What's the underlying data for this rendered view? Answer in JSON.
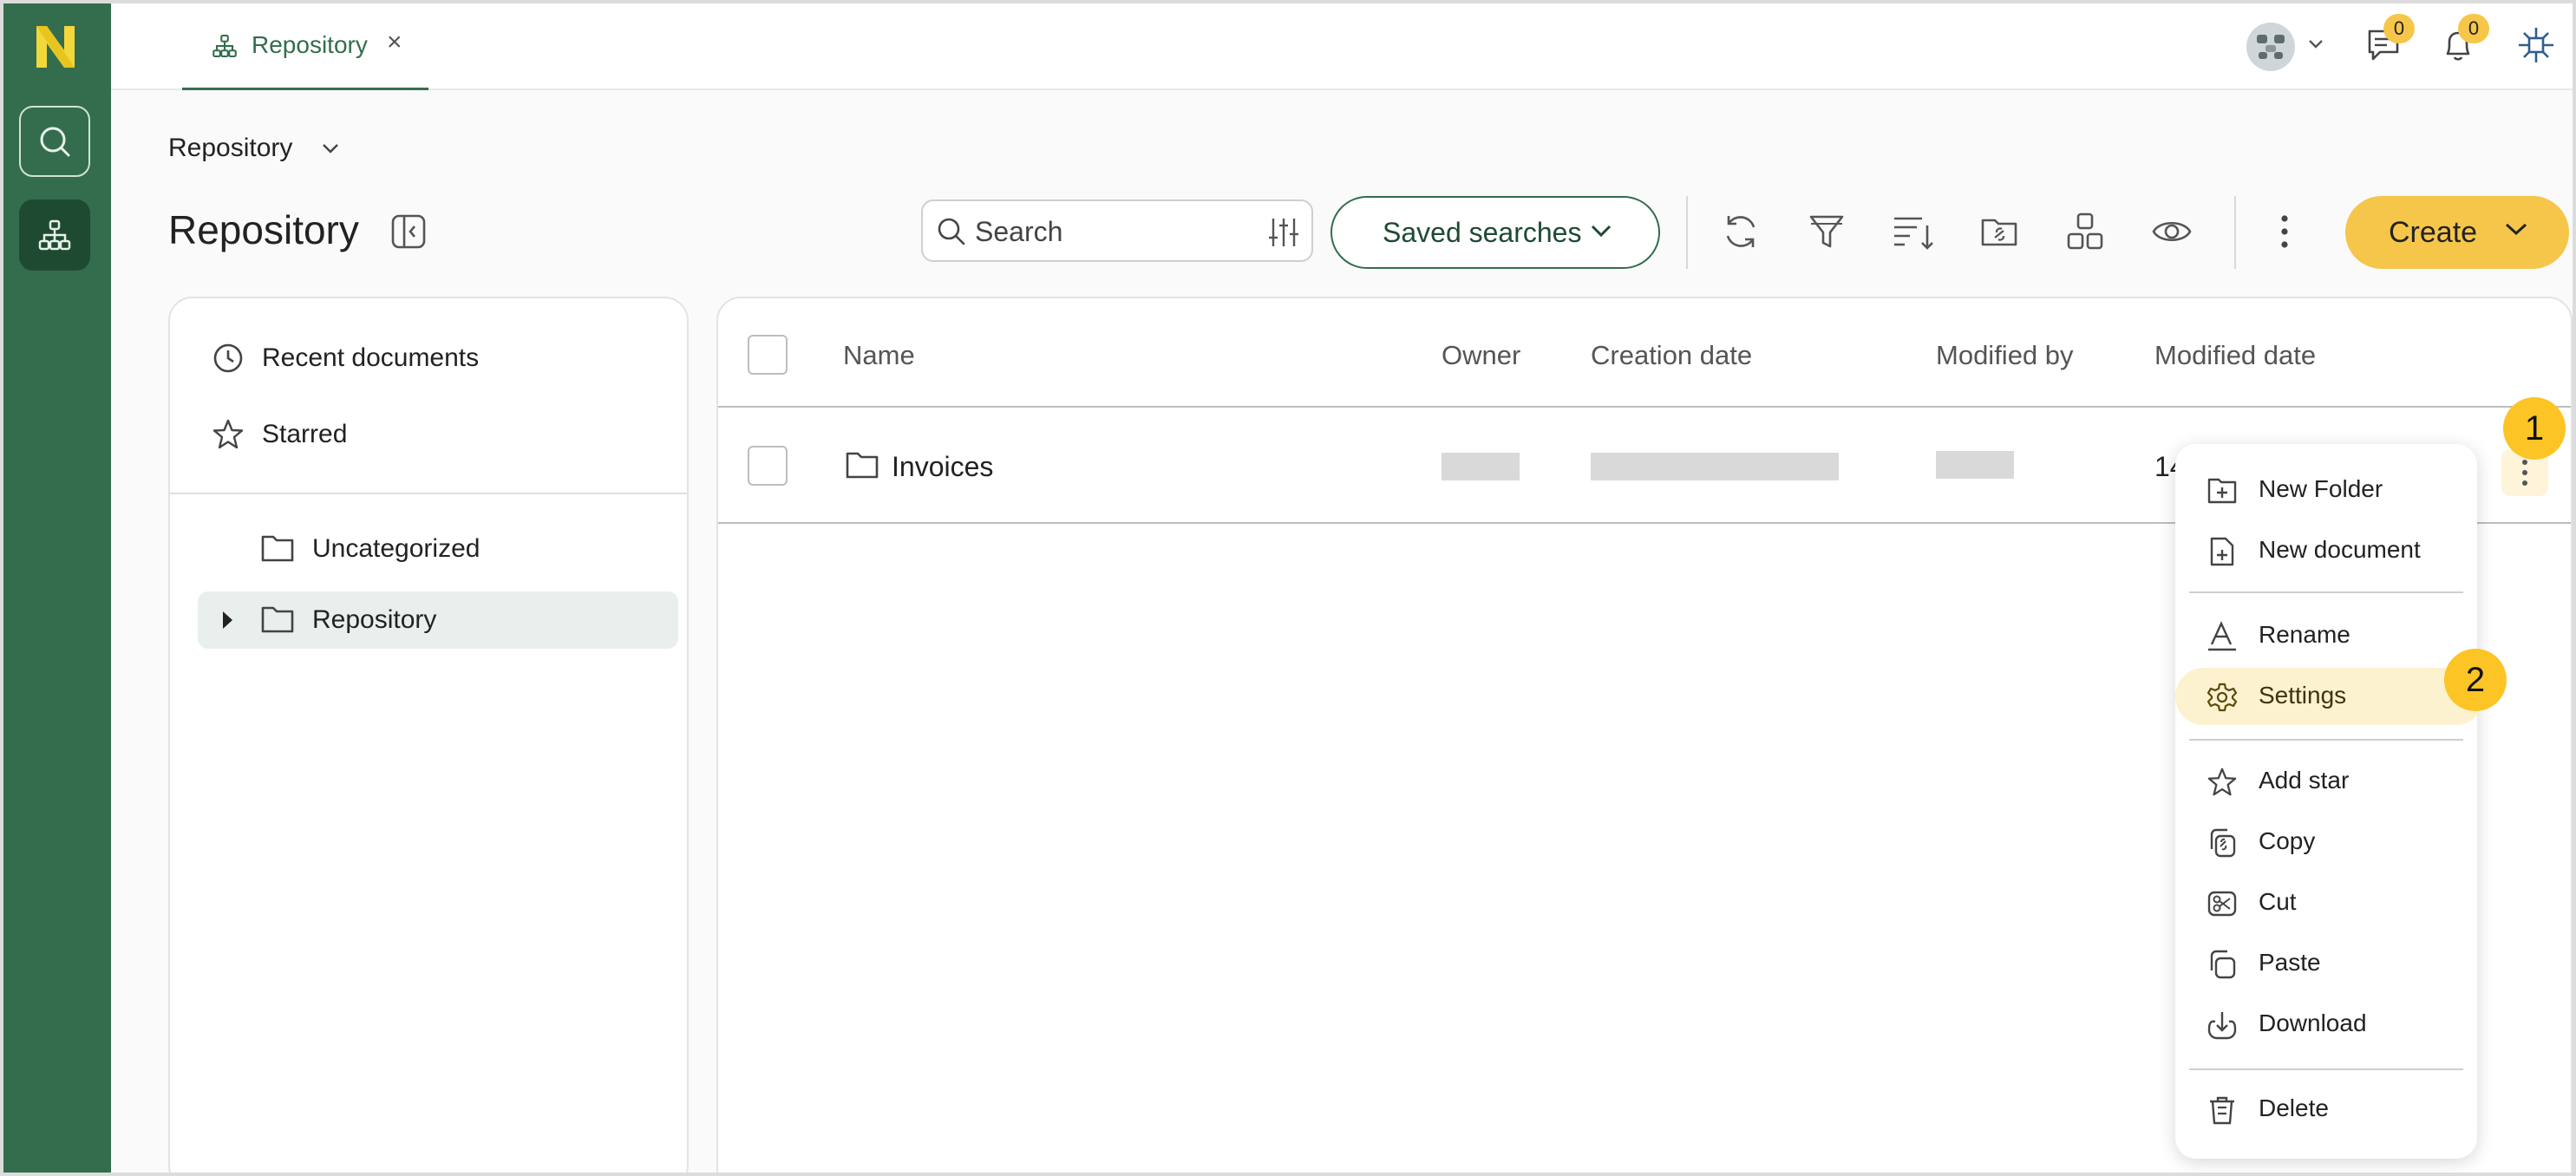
{
  "tab": {
    "label": "Repository",
    "close": "×"
  },
  "header": {
    "badges": {
      "messages": "0",
      "notifications": "0"
    }
  },
  "page": {
    "breadcrumb": "Repository",
    "title": "Repository"
  },
  "search": {
    "placeholder": "Search"
  },
  "toolbar": {
    "saved_searches": "Saved searches",
    "create": "Create"
  },
  "sidebar": {
    "recent": "Recent documents",
    "starred": "Starred",
    "tree": [
      {
        "label": "Uncategorized"
      },
      {
        "label": "Repository"
      }
    ]
  },
  "table": {
    "columns": [
      "Name",
      "Owner",
      "Creation date",
      "Modified by",
      "Modified date"
    ],
    "rows": [
      {
        "name": "Invoices",
        "modified_date": "14"
      }
    ]
  },
  "context_menu": {
    "items": [
      {
        "label": "New Folder"
      },
      {
        "label": "New document"
      },
      {
        "label": "Rename"
      },
      {
        "label": "Settings"
      },
      {
        "label": "Add star"
      },
      {
        "label": "Copy"
      },
      {
        "label": "Cut"
      },
      {
        "label": "Paste"
      },
      {
        "label": "Download"
      },
      {
        "label": "Delete"
      }
    ]
  },
  "steps": {
    "one": "1",
    "two": "2"
  },
  "colors": {
    "brand_green": "#336d4d",
    "accent_yellow": "#f6c64a",
    "selected_bg": "#e8efec"
  }
}
